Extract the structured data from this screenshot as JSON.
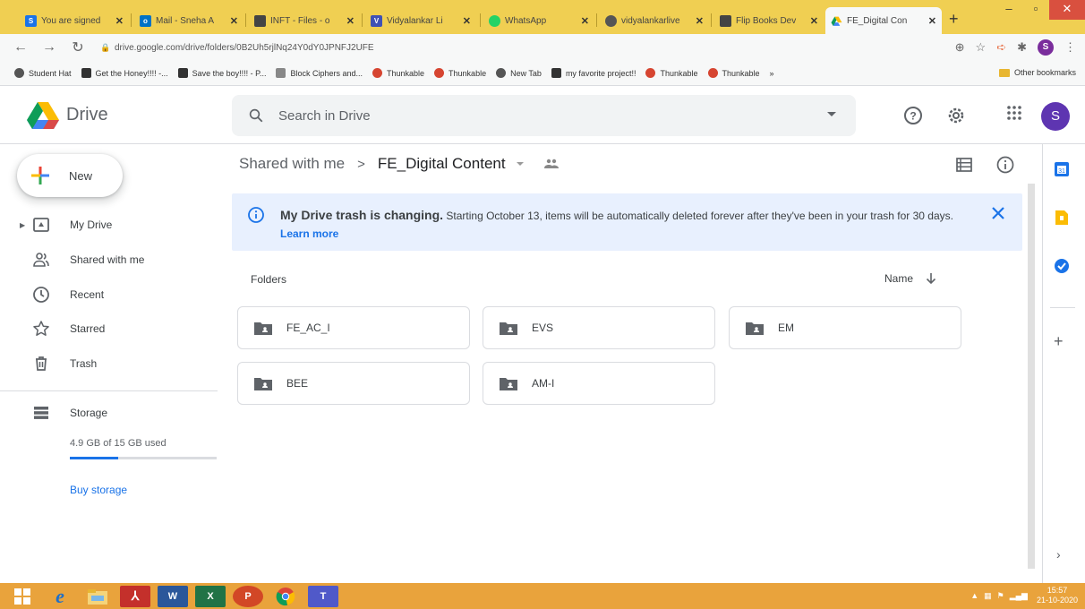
{
  "browser": {
    "tabs": [
      {
        "title": "You are signed",
        "favicon_color": "#1a73e8",
        "favicon_letter": "S"
      },
      {
        "title": "Mail - Sneha A",
        "favicon_color": "#0072c6",
        "favicon_letter": "o"
      },
      {
        "title": "INFT - Files - o",
        "favicon_color": "#444",
        "favicon_letter": ""
      },
      {
        "title": "Vidyalankar Li",
        "favicon_color": "#3f51b5",
        "favicon_letter": "V"
      },
      {
        "title": "WhatsApp",
        "favicon_color": "#25d366",
        "favicon_letter": ""
      },
      {
        "title": "vidyalankarlive",
        "favicon_color": "#555",
        "favicon_letter": ""
      },
      {
        "title": "Flip Books Dev",
        "favicon_color": "#444",
        "favicon_letter": ""
      },
      {
        "title": "FE_Digital Con",
        "favicon_color": "#f4b400",
        "favicon_letter": ""
      }
    ],
    "url": "drive.google.com/drive/folders/0B2Uh5rjlNq24Y0dY0JPNFJ2UFE",
    "profile_letter": "S",
    "bookmarks": [
      "Student Hat",
      "Get the Honey!!!! -...",
      "Save the boy!!!! - P...",
      "Block Ciphers and...",
      "Thunkable",
      "Thunkable",
      "New Tab",
      "my favorite project!!",
      "Thunkable",
      "Thunkable"
    ],
    "bookmarks_more": "»",
    "other_bookmarks": "Other bookmarks"
  },
  "header": {
    "logo_text": "Drive",
    "search_placeholder": "Search in Drive",
    "avatar_letter": "S"
  },
  "sidebar": {
    "new_label": "New",
    "items": [
      {
        "label": "My Drive",
        "icon": "my-drive-icon"
      },
      {
        "label": "Shared with me",
        "icon": "shared-icon"
      },
      {
        "label": "Recent",
        "icon": "clock-icon"
      },
      {
        "label": "Starred",
        "icon": "star-icon"
      },
      {
        "label": "Trash",
        "icon": "trash-icon"
      }
    ],
    "storage_label": "Storage",
    "storage_text": "4.9 GB of 15 GB used",
    "storage_fraction": 0.33,
    "buy_storage": "Buy storage"
  },
  "main": {
    "breadcrumb": {
      "parent": "Shared with me",
      "separator": ">",
      "current": "FE_Digital Content"
    },
    "banner": {
      "title": "My Drive trash is changing.",
      "body": " Starting October 13, items will be automatically deleted forever after they've been in your trash for 30 days. ",
      "link": "Learn more"
    },
    "folders_label": "Folders",
    "sort_label": "Name",
    "folders": [
      "FE_AC_I",
      "EVS",
      "EM",
      "BEE",
      "AM-I"
    ]
  },
  "taskbar": {
    "time": "15:57",
    "date": "21-10-2020"
  },
  "colors": {
    "accent": "#1a73e8",
    "avatar": "#5e35b1",
    "banner_bg": "#e8f0fe",
    "tabbar": "#f0cf52",
    "taskbar": "#e9a33c"
  }
}
